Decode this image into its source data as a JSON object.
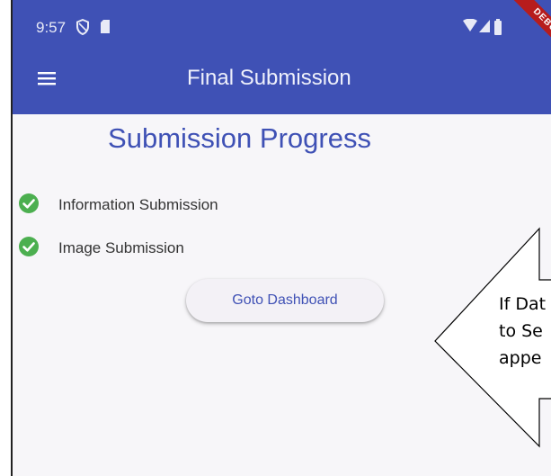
{
  "status_bar": {
    "time": "9:57",
    "icons": [
      "shield-icon",
      "sim-card-icon",
      "wifi-icon",
      "signal-icon",
      "battery-icon"
    ]
  },
  "app_bar": {
    "title": "Final Submission",
    "menu_icon": "hamburger-menu-icon",
    "color": "#3f51b5"
  },
  "debug_banner": "DEBUG",
  "main": {
    "heading": "Submission Progress",
    "steps": [
      {
        "label": "Information Submission",
        "status": "complete",
        "icon": "check-circle-icon",
        "color": "#4caf50"
      },
      {
        "label": "Image Submission",
        "status": "complete",
        "icon": "check-circle-icon",
        "color": "#4caf50"
      }
    ],
    "button_label": "Goto Dashboard"
  },
  "callout": {
    "lines": [
      "If Dat",
      "to Se",
      "appe"
    ]
  }
}
